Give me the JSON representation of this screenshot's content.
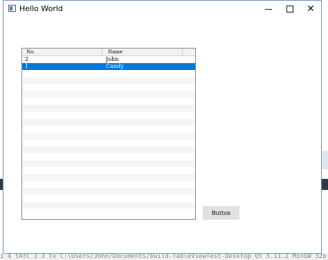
{
  "window": {
    "title": "Hello World"
  },
  "table": {
    "headers": [
      "No.",
      "Name"
    ],
    "rows": [
      {
        "no": "2",
        "name": "John"
      },
      {
        "no": "1",
        "name": "Candy"
      }
    ],
    "selected_row": 1,
    "empty_rows": 21
  },
  "button": {
    "label": "Button"
  },
  "colors": {
    "selection": "#0078d7",
    "button_bg": "#e1e1e1"
  },
  "background": {
    "terminal_text": "1 4 tAfC 1 3 tv C:\\Users/John/Documents/build-TableViewTest-Desktop Qt 5.11.2 MinGW 32b"
  }
}
